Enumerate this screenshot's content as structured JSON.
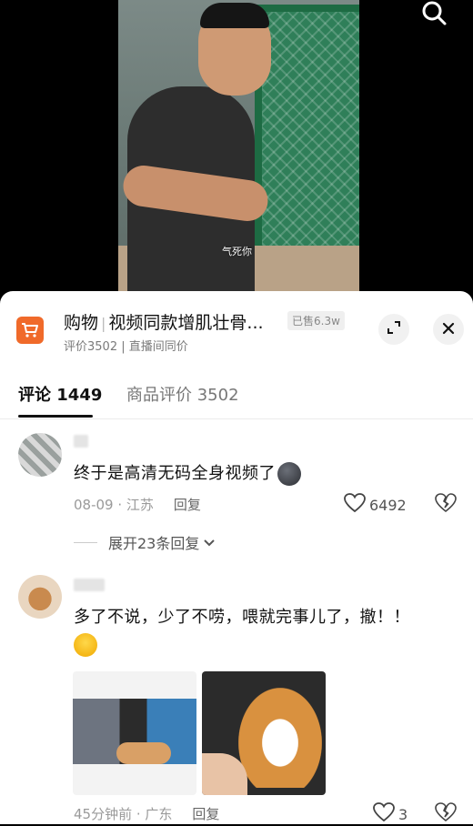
{
  "video": {
    "caption": "气死你",
    "search_icon": "search-icon"
  },
  "shop": {
    "title_prefix": "购物",
    "title_name": "视频同款增肌壮骨...",
    "sold": "已售6.3w",
    "subtitle": "评价3502 | 直播间同价",
    "accent_color": "#f06a2a"
  },
  "tabs": [
    {
      "label": "评论 1449",
      "active": true
    },
    {
      "label": "商品评价 3502",
      "active": false
    }
  ],
  "comments": [
    {
      "text": "终于是高清无码全身视频了",
      "date": "08-09",
      "location": "江苏",
      "reply_label": "回复",
      "likes": "6492",
      "expand_label": "展开23条回复"
    },
    {
      "text": "多了不说，少了不唠，喂就完事儿了，撤！！",
      "date": "45分钟前",
      "location": "广东",
      "reply_label": "回复",
      "likes": "3"
    }
  ]
}
